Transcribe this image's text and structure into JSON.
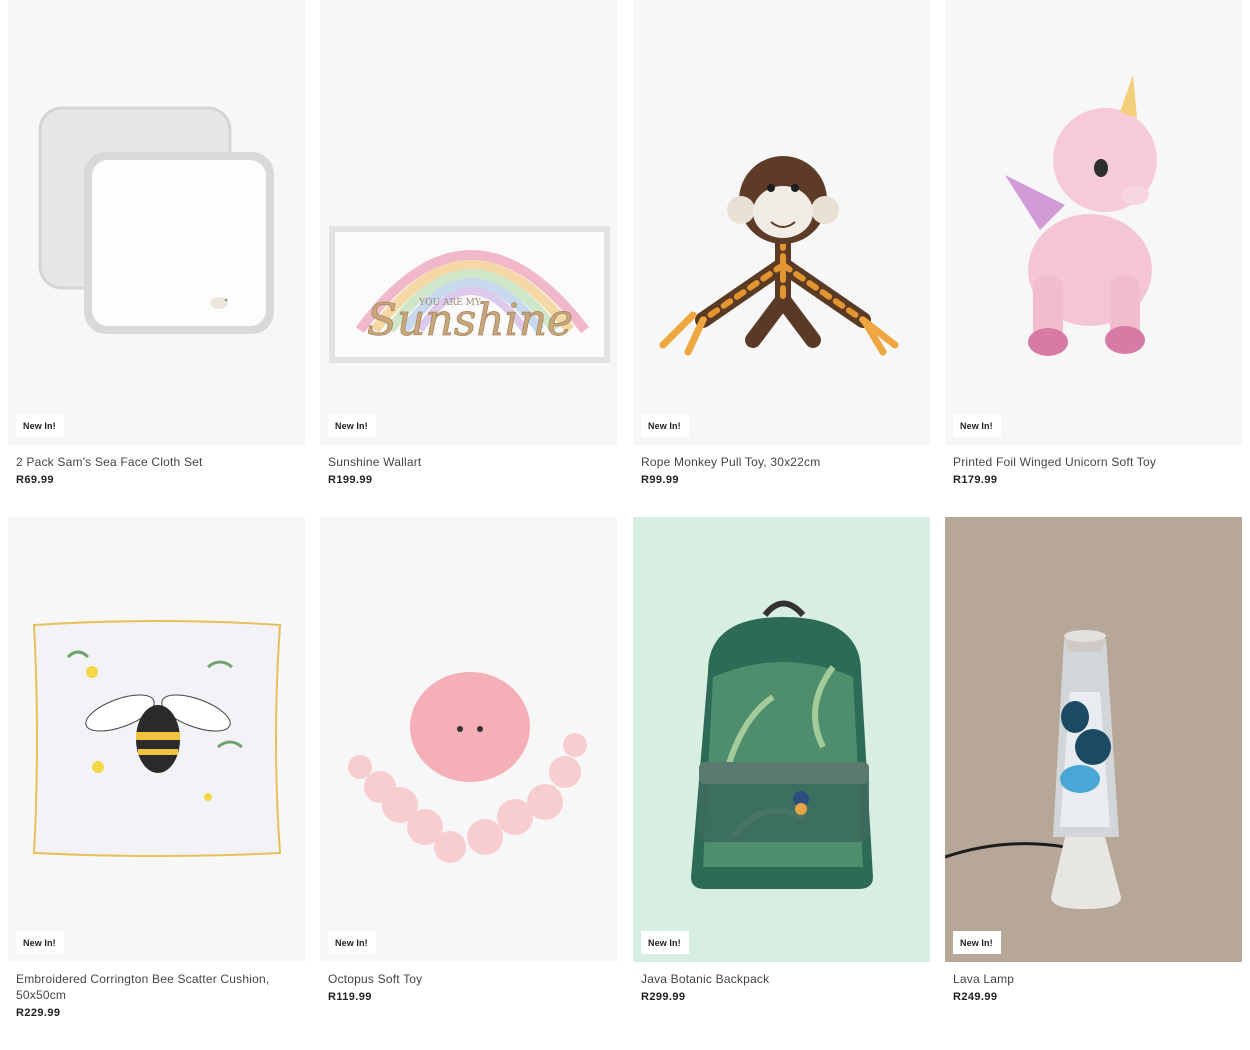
{
  "products": [
    {
      "badge": "New In!",
      "title": "2 Pack Sam's Sea Face Cloth Set",
      "price": "R69.99",
      "image": "face-cloth-set-image"
    },
    {
      "badge": "New In!",
      "title": "Sunshine Wallart",
      "price": "R199.99",
      "image": "sunshine-wallart-image",
      "art_text_top": "YOU ARE MY",
      "art_text": "Sunshine"
    },
    {
      "badge": "New In!",
      "title": "Rope Monkey Pull Toy, 30x22cm",
      "price": "R99.99",
      "image": "rope-monkey-image"
    },
    {
      "badge": "New In!",
      "title": "Printed Foil Winged Unicorn Soft Toy",
      "price": "R179.99",
      "image": "unicorn-soft-toy-image"
    },
    {
      "badge": "New In!",
      "title": "Embroidered Corrington Bee Scatter Cushion, 50x50cm",
      "price": "R229.99",
      "image": "bee-cushion-image"
    },
    {
      "badge": "New In!",
      "title": "Octopus Soft Toy",
      "price": "R119.99",
      "image": "octopus-soft-toy-image"
    },
    {
      "badge": "New In!",
      "title": "Java Botanic Backpack",
      "price": "R299.99",
      "image": "botanic-backpack-image"
    },
    {
      "badge": "New In!",
      "title": "Lava Lamp",
      "price": "R249.99",
      "image": "lava-lamp-image"
    }
  ],
  "colors": {
    "card_bg": "#f7f7f7",
    "backpack_bg": "#d7eee1",
    "lamp_bg": "#b7a799"
  }
}
